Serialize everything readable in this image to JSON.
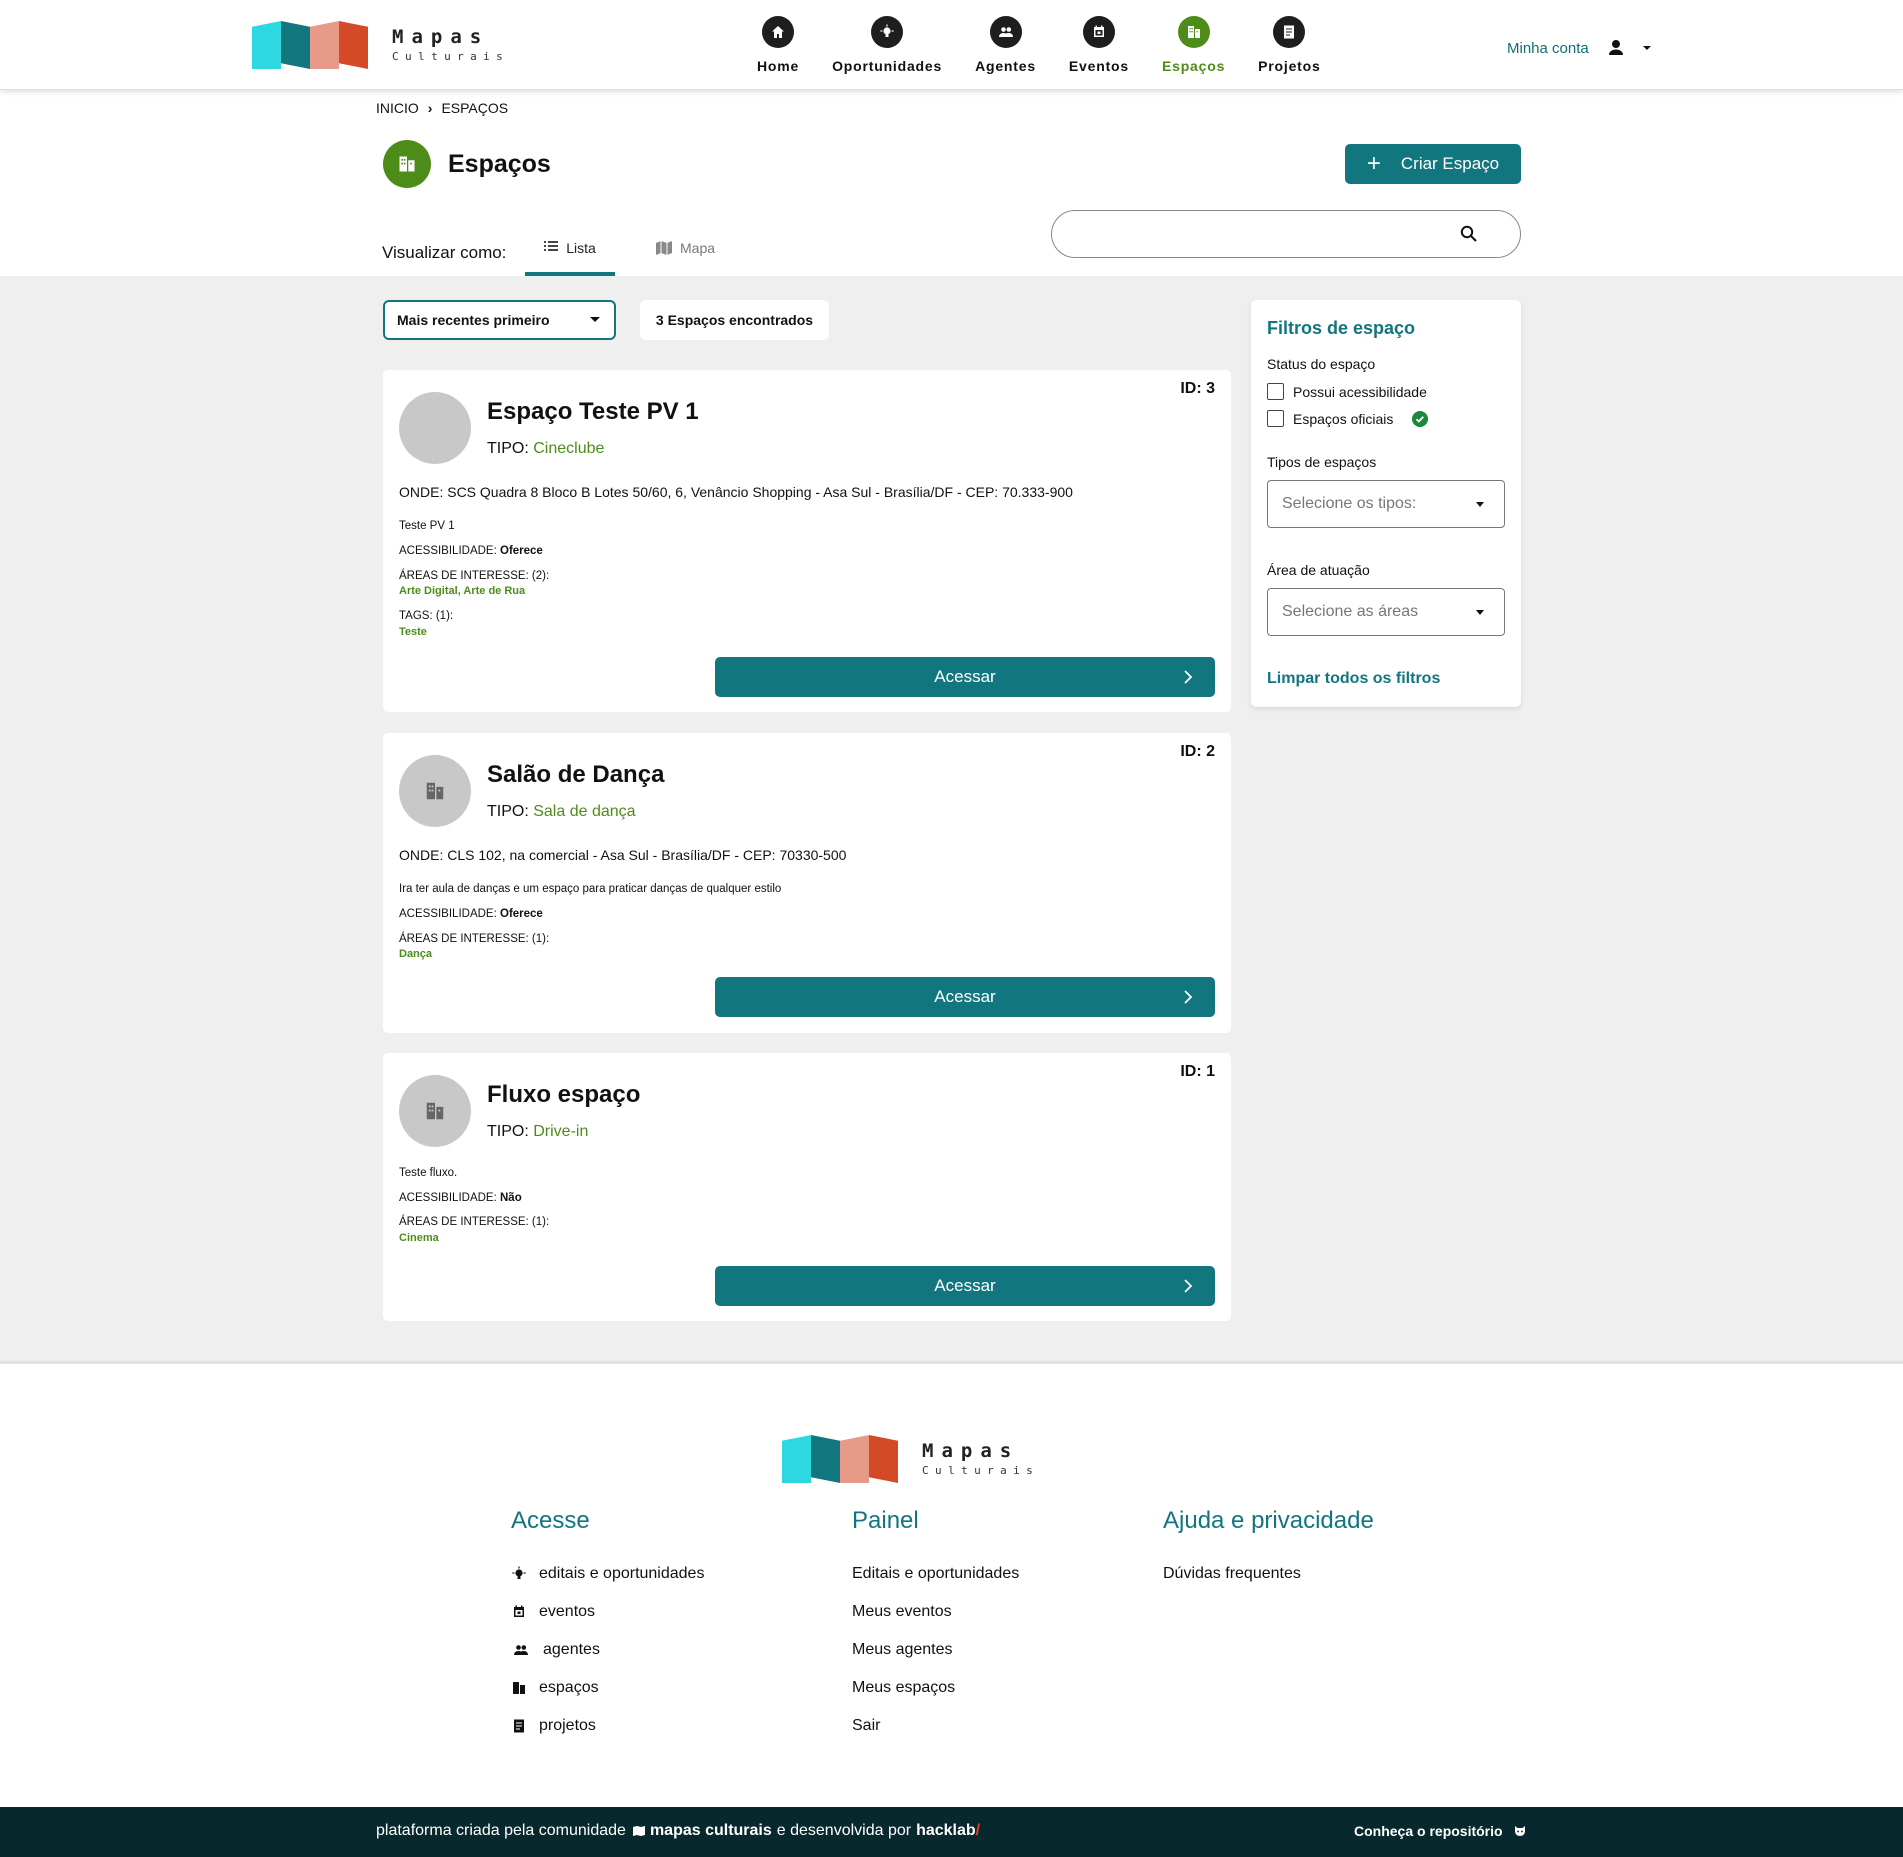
{
  "brand": {
    "title": "Mapas",
    "subtitle": "Culturais",
    "colors": [
      "#2ed8e0",
      "#12767f",
      "#e89a88",
      "#d54a26"
    ]
  },
  "nav": {
    "items": [
      {
        "label": "Home",
        "icon": "home-icon"
      },
      {
        "label": "Oportunidades",
        "icon": "lightbulb-icon"
      },
      {
        "label": "Agentes",
        "icon": "people-icon"
      },
      {
        "label": "Eventos",
        "icon": "calendar-icon"
      },
      {
        "label": "Espaços",
        "icon": "building-icon"
      },
      {
        "label": "Projetos",
        "icon": "document-icon"
      }
    ],
    "active": "Espaços",
    "account_label": "Minha conta"
  },
  "breadcrumb": {
    "items": [
      "INICIO",
      "ESPAÇOS"
    ]
  },
  "page": {
    "title": "Espaços",
    "create_label": "Criar Espaço",
    "accent": "#4e8c19",
    "primary": "#12767f"
  },
  "view": {
    "label": "Visualizar como:",
    "tabs": [
      "Lista",
      "Mapa"
    ],
    "active": "Lista"
  },
  "search": {
    "placeholder": "",
    "value": ""
  },
  "list": {
    "sort_label": "Mais recentes primeiro",
    "count_label": "3 Espaços encontrados",
    "cards": [
      {
        "id": "ID: 3",
        "name": "Espaço Teste PV 1",
        "tipo_label": "TIPO:",
        "tipo": "Cineclube",
        "onde": "ONDE: SCS Quadra 8 Bloco B Lotes 50/60, 6, Venâncio Shopping - Asa Sul - Brasília/DF - CEP: 70.333-900",
        "desc": "Teste PV 1",
        "acess_label": "ACESSIBILIDADE:",
        "acess": "Oferece",
        "areas_label": "ÁREAS DE INTERESSE: (2):",
        "areas": "Arte Digital, Arte de Rua",
        "tags_label": "TAGS: (1):",
        "tags": "Teste",
        "button": "Acessar"
      },
      {
        "id": "ID: 2",
        "name": "Salão de Dança",
        "tipo_label": "TIPO:",
        "tipo": "Sala de dança",
        "onde": "ONDE: CLS 102, na comercial - Asa Sul - Brasília/DF - CEP: 70330-500",
        "desc": "Ira ter aula de danças e um espaço para praticar danças de qualquer estilo",
        "acess_label": "ACESSIBILIDADE:",
        "acess": "Oferece",
        "areas_label": "ÁREAS DE INTERESSE: (1):",
        "areas": "Dança",
        "button": "Acessar"
      },
      {
        "id": "ID: 1",
        "name": "Fluxo espaço",
        "tipo_label": "TIPO:",
        "tipo": "Drive-in",
        "desc": "Teste fluxo.",
        "acess_label": "ACESSIBILIDADE:",
        "acess": "Não",
        "areas_label": "ÁREAS DE INTERESSE: (1):",
        "areas": "Cinema",
        "button": "Acessar"
      }
    ]
  },
  "filters": {
    "title": "Filtros de espaço",
    "status_label": "Status do espaço",
    "checkboxes": [
      "Possui acessibilidade",
      "Espaços oficiais"
    ],
    "tipos_label": "Tipos de espaços",
    "tipos_placeholder": "Selecione os tipos:",
    "area_label": "Área de atuação",
    "area_placeholder": "Selecione as áreas",
    "clear_label": "Limpar todos os filtros"
  },
  "footer": {
    "columns": [
      {
        "title": "Acesse",
        "links": [
          {
            "label": "editais e oportunidades",
            "icon": "lightbulb-icon"
          },
          {
            "label": "eventos",
            "icon": "calendar-icon"
          },
          {
            "label": "agentes",
            "icon": "people-icon"
          },
          {
            "label": "espaços",
            "icon": "building-icon"
          },
          {
            "label": "projetos",
            "icon": "document-icon"
          }
        ]
      },
      {
        "title": "Painel",
        "links": [
          {
            "label": "Editais e oportunidades"
          },
          {
            "label": "Meus eventos"
          },
          {
            "label": "Meus agentes"
          },
          {
            "label": "Meus espaços"
          },
          {
            "label": "Sair"
          }
        ]
      },
      {
        "title": "Ajuda e privacidade",
        "links": [
          {
            "label": "Dúvidas frequentes"
          }
        ]
      }
    ],
    "credit_prefix": "plataforma criada pela comunidade",
    "credit_brand": "mapas culturais",
    "credit_middle": "e desenvolvida por",
    "credit_dev": "hacklab",
    "credit_slash": "/",
    "repo_label": "Conheça o repositório"
  }
}
